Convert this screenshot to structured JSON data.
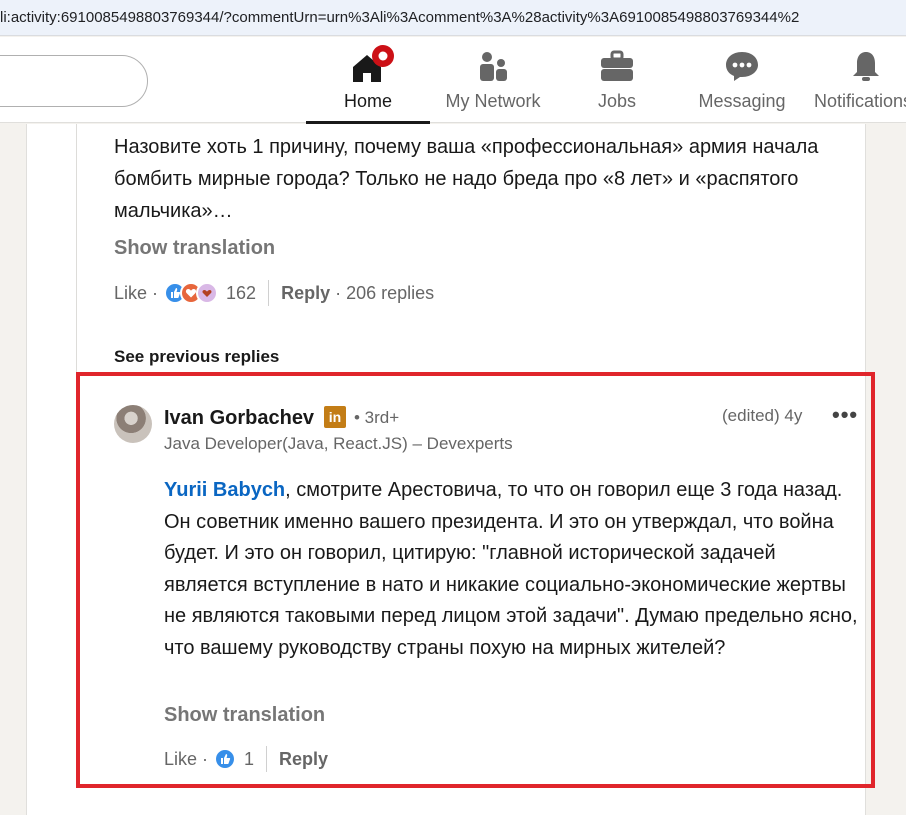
{
  "browser": {
    "url": "li:activity:6910085498803769344/?commentUrn=urn%3Ali%3Acomment%3A%28activity%3A6910085498803769344%2"
  },
  "nav": {
    "items": [
      {
        "label": "Home",
        "icon": "home-icon"
      },
      {
        "label": "My Network",
        "icon": "network-icon"
      },
      {
        "label": "Jobs",
        "icon": "briefcase-icon"
      },
      {
        "label": "Messaging",
        "icon": "messaging-icon"
      },
      {
        "label": "Notifications",
        "icon": "bell-icon"
      }
    ],
    "active": "Home"
  },
  "parent_comment": {
    "text": "Назовите хоть 1 причину, почему ваша «профессиональная» армия начала бомбить мирные города? Только не надо бреда про «8 лет» и «распятого мальчика»…",
    "show_translation": "Show translation",
    "like_label": "Like",
    "reaction_count": "162",
    "reply_label": "Reply",
    "replies_count": "206 replies"
  },
  "see_previous": "See previous replies",
  "reply": {
    "author": "Ivan Gorbachev",
    "degree": "• 3rd+",
    "headline": "Java Developer(Java, React.JS) – Devexperts",
    "meta": "(edited) 4y",
    "mention": "Yurii Babych",
    "text": ", смотрите Арестовича, то что он говорил еще 3 года назад. Он советник именно вашего президента. И это он утверждал, что война будет. И это он говорил, цитирую: \"главной исторической задачей является вступление в нато и никакие социально-экономические жертвы не являются таковыми перед лицом этой задачи\". Думаю предельно ясно, что вашему руководству страны похую на мирных жителей?",
    "show_translation": "Show translation",
    "like_label": "Like",
    "reaction_count": "1",
    "reply_label": "Reply"
  },
  "colors": {
    "highlight_border": "#e0252b",
    "link": "#0a66c2",
    "notification_red": "#cc1016"
  }
}
